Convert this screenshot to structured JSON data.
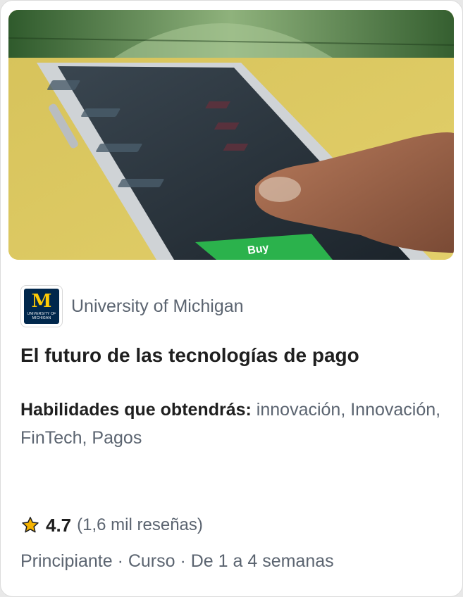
{
  "card": {
    "image_alt": "Smartphone trading app with finger pressing Buy, dollar bill in background",
    "image_button_text": "Buy",
    "partner": {
      "logo_letter": "M",
      "logo_subtext": "UNIVERSITY OF MICHIGAN",
      "name": "University of Michigan"
    },
    "title": "El futuro de las tecnologías de pago",
    "skills": {
      "label": "Habilidades que obtendrás:",
      "values": "innovación, Innovación, FinTech, Pagos"
    },
    "rating": {
      "value": "4.7",
      "count": "(1,6 mil reseñas)",
      "star_color": "#f5b301"
    },
    "meta": "Principiante · Curso · De 1 a 4 semanas"
  },
  "colors": {
    "logo_background": "#00274c",
    "logo_letter": "#ffcb05",
    "title_text": "#1f1f1f",
    "secondary_text": "#5b6470"
  }
}
